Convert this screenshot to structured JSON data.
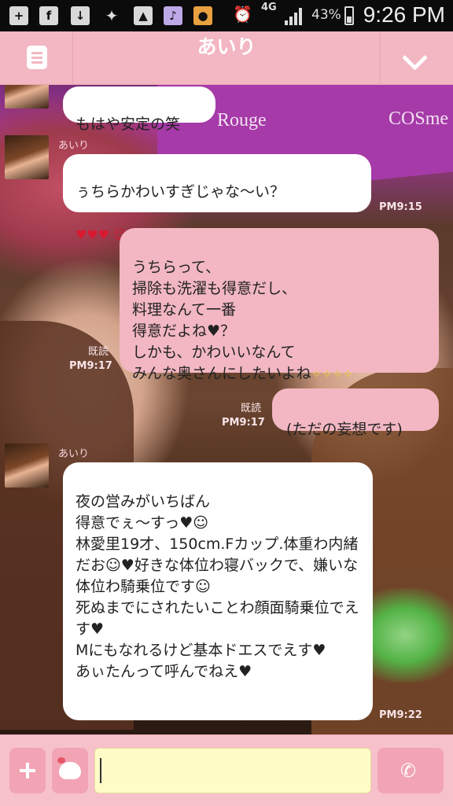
{
  "status_bar": {
    "icons": [
      "add-icon",
      "facebook-icon",
      "download-icon",
      "twitter-icon",
      "gallery-icon",
      "music-icon",
      "app-icon"
    ],
    "network": "4G",
    "battery": "43%",
    "time": "9:26 PM"
  },
  "header": {
    "title": "あいり"
  },
  "messages": [
    {
      "id": "m1",
      "side": "in",
      "text": "もはや安定の笑"
    },
    {
      "id": "m2",
      "side": "in",
      "sender": "あいり",
      "text": "ぅちらかわいすぎじゃな〜い？",
      "emoji": "♥♥♥ ☺",
      "time": "PM9:15"
    },
    {
      "id": "m3",
      "side": "out",
      "text": "うちらって、\n掃除も洗濯も得意だし、\n料理なんて一番\n得意だよね♥？\nしかも、かわいいなんて\nみんな奥さんにしたいよね",
      "emoji": "✧✧✧✧",
      "read": "既読",
      "time": "PM9:17"
    },
    {
      "id": "m4",
      "side": "out",
      "text": "(ただの妄想です)",
      "read": "既読",
      "time": "PM9:17"
    },
    {
      "id": "m5",
      "side": "in",
      "sender": "あいり",
      "text": "夜の営みがいちばん\n得意でぇ〜すっ♥☺\n林愛里19才、150cm.Fカップ.体重わ内緒だお☺♥好きな体位わ寝バックで、嫌いな体位わ騎乗位です☺\n死ぬまでにされたいことわ顔面騎乗位でえす♥\nMにもなれるけど基本ドエスでえす♥\nあぃたんって呼んでねえ♥",
      "time": "PM9:22"
    }
  ],
  "input_bar": {
    "placeholder": ""
  },
  "colors": {
    "header_bg": "#f2b7c2",
    "out_bubble": "#f2b7c2",
    "in_bubble": "#ffffff",
    "input_field": "#fffcc8"
  }
}
